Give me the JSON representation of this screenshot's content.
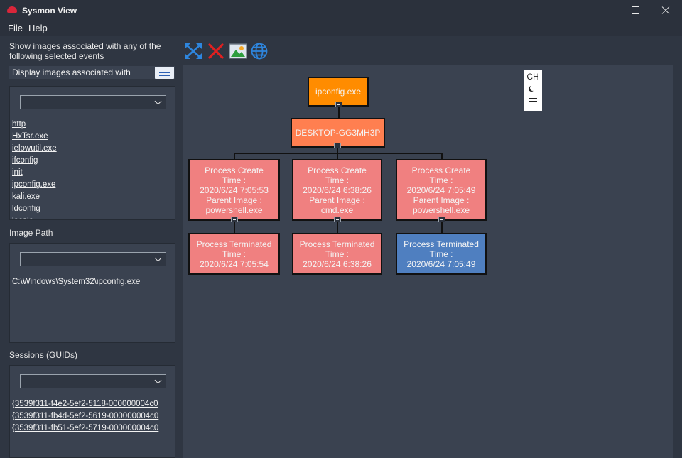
{
  "window": {
    "title": "Sysmon View"
  },
  "menu": {
    "file": "File",
    "help": "Help"
  },
  "left": {
    "description": "Show images associated with any of the following selected events",
    "display_label": "Display images associated with",
    "images": [
      "http",
      "HxTsr.exe",
      "ielowutil.exe",
      "ifconfig",
      "init",
      "ipconfig.exe",
      "kali.exe",
      "ldconfig",
      "locale"
    ],
    "image_path_label": "Image Path",
    "image_paths": [
      "C:\\Windows\\System32\\ipconfig.exe"
    ],
    "sessions_label": "Sessions (GUIDs)",
    "sessions": [
      "{3539f311-f4e2-5ef2-5118-000000004c0",
      "{3539f311-fb4d-5ef2-5619-000000004c0",
      "{3539f311-fb51-5ef2-5719-000000004c0"
    ]
  },
  "toolbar": {
    "icons": [
      "expand-icon",
      "clear-icon",
      "image-export-icon",
      "globe-icon"
    ]
  },
  "tree": {
    "root": "ipconfig.exe",
    "host": "DESKTOP-GG3MH3P",
    "branches": [
      {
        "create": {
          "l1": "Process Create",
          "l2": "Time :",
          "l3": "2020/6/24 7:05:53",
          "l4": "Parent Image :",
          "l5": "powershell.exe"
        },
        "term": {
          "l1": "Process Terminated",
          "l2": "Time :",
          "l3": "2020/6/24 7:05:54"
        }
      },
      {
        "create": {
          "l1": "Process Create",
          "l2": "Time :",
          "l3": "2020/6/24 6:38:26",
          "l4": "Parent Image :",
          "l5": "cmd.exe"
        },
        "term": {
          "l1": "Process Terminated",
          "l2": "Time :",
          "l3": "2020/6/24 6:38:26"
        }
      },
      {
        "create": {
          "l1": "Process Create",
          "l2": "Time :",
          "l3": "2020/6/24 7:05:49",
          "l4": "Parent Image :",
          "l5": "powershell.exe"
        },
        "term": {
          "l1": "Process Terminated",
          "l2": "Time :",
          "l3": "2020/6/24 7:05:49"
        }
      }
    ],
    "minimap": {
      "label": "CH"
    }
  },
  "colors": {
    "root": "#ff8c00",
    "host": "#ff7f50",
    "event": "#f08080",
    "selected": "#4f7fc0",
    "canvas": "#3a4250"
  }
}
